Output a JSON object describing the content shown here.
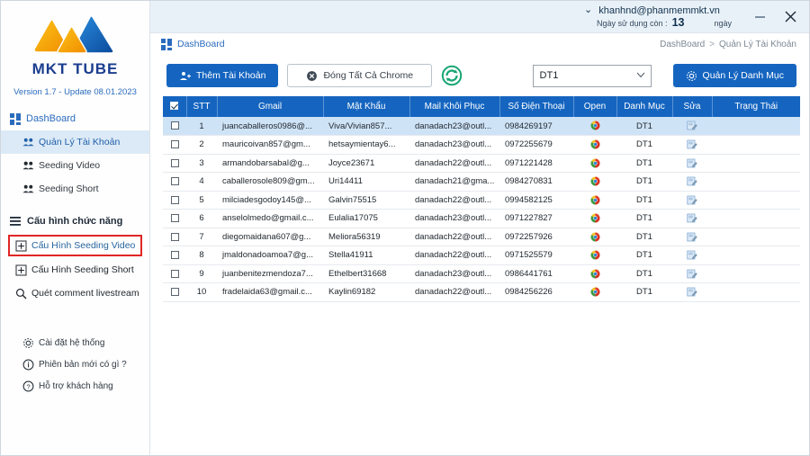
{
  "app": {
    "logo_text": "MKT TUBE",
    "version": "Version 1.7 - Update 08.01.2023"
  },
  "titlebar": {
    "chevron": "⌄",
    "email": "khanhnd@phanmemmkt.vn",
    "days_label": "Ngày sử dụng còn :",
    "days_value": "13",
    "days_unit": "ngày",
    "minimize": "—",
    "close": "✕"
  },
  "sidebar": {
    "dashboard": "DashBoard",
    "items": [
      {
        "label": "Quản Lý Tài Khoản",
        "icon": "users-icon",
        "active": true
      },
      {
        "label": "Seeding Video",
        "icon": "users-icon",
        "active": false
      },
      {
        "label": "Seeding Short",
        "icon": "users-icon",
        "active": false
      }
    ],
    "section_title": "Cấu hình chức năng",
    "config_items": [
      {
        "label": "Cấu Hình Seeding Video",
        "icon": "form-icon",
        "boxed": true
      },
      {
        "label": "Cấu Hình Seeding Short",
        "icon": "form-icon",
        "boxed": false
      },
      {
        "label": "Quét comment livestream",
        "icon": "search-icon",
        "boxed": false
      }
    ],
    "bottom_items": [
      {
        "label": "Cài đặt hệ thống",
        "icon": "gear-icon"
      },
      {
        "label": "Phiên bản mới có gì ?",
        "icon": "info-icon"
      },
      {
        "label": "Hỗ trợ khách hàng",
        "icon": "help-icon"
      }
    ]
  },
  "content": {
    "page_label": "DashBoard",
    "breadcrumb": {
      "root": "DashBoard",
      "sep": ">",
      "current": "Quản Lý Tài Khoản"
    },
    "add_account_button": "Thêm Tài Khoản",
    "close_chrome_button": "Đóng Tất Cả Chrome",
    "refresh_icon": "refresh-icon",
    "category_select_value": "DT1",
    "manage_category_button": "Quản Lý Danh Mục"
  },
  "table": {
    "columns": [
      "",
      "STT",
      "Gmail",
      "Mật Khẩu",
      "Mail Khôi Phục",
      "Số Điện Thoại",
      "Open",
      "Danh Mục",
      "Sửa",
      "Trạng Thái"
    ],
    "rows": [
      {
        "stt": "1",
        "gmail": "juancaballeros0986@...",
        "password": "Viva/Vivian857...",
        "recovery": "danadach23@outl...",
        "phone": "0984269197",
        "category": "DT1",
        "status": "",
        "selected": true
      },
      {
        "stt": "2",
        "gmail": "mauricoivan857@gm...",
        "password": "hetsaymientay6...",
        "recovery": "danadach23@outl...",
        "phone": "0972255679",
        "category": "DT1",
        "status": "",
        "selected": false
      },
      {
        "stt": "3",
        "gmail": "armandobarsabal@g...",
        "password": "Joyce23671",
        "recovery": "danadach22@outl...",
        "phone": "0971221428",
        "category": "DT1",
        "status": "",
        "selected": false
      },
      {
        "stt": "4",
        "gmail": "caballerosole809@gm...",
        "password": "Uri14411",
        "recovery": "danadach21@gma...",
        "phone": "0984270831",
        "category": "DT1",
        "status": "",
        "selected": false
      },
      {
        "stt": "5",
        "gmail": "milciadesgodoy145@...",
        "password": "Galvin75515",
        "recovery": "danadach22@outl...",
        "phone": "0994582125",
        "category": "DT1",
        "status": "",
        "selected": false
      },
      {
        "stt": "6",
        "gmail": "anselolmedo@gmail.c...",
        "password": "Eulalia17075",
        "recovery": "danadach23@outl...",
        "phone": "0971227827",
        "category": "DT1",
        "status": "",
        "selected": false
      },
      {
        "stt": "7",
        "gmail": "diegomaidana607@g...",
        "password": "Meliora56319",
        "recovery": "danadach22@outl...",
        "phone": "0972257926",
        "category": "DT1",
        "status": "",
        "selected": false
      },
      {
        "stt": "8",
        "gmail": "jmaldonadoamoa7@g...",
        "password": "Stella41911",
        "recovery": "danadach22@outl...",
        "phone": "0971525579",
        "category": "DT1",
        "status": "",
        "selected": false
      },
      {
        "stt": "9",
        "gmail": "juanbenitezmendoza7...",
        "password": "Ethelbert31668",
        "recovery": "danadach23@outl...",
        "phone": "0986441761",
        "category": "DT1",
        "status": "",
        "selected": false
      },
      {
        "stt": "10",
        "gmail": "fradelaida63@gmail.c...",
        "password": "Kaylin69182",
        "recovery": "danadach22@outl...",
        "phone": "0984256226",
        "category": "DT1",
        "status": "",
        "selected": false
      }
    ]
  },
  "colors": {
    "primary": "#1565c0",
    "header_bg": "#e9f1f8",
    "highlight_box": "#e02626",
    "row_selected": "#cfe3f7",
    "logo_orange": "#f5a623",
    "logo_blue": "#1565c0"
  }
}
